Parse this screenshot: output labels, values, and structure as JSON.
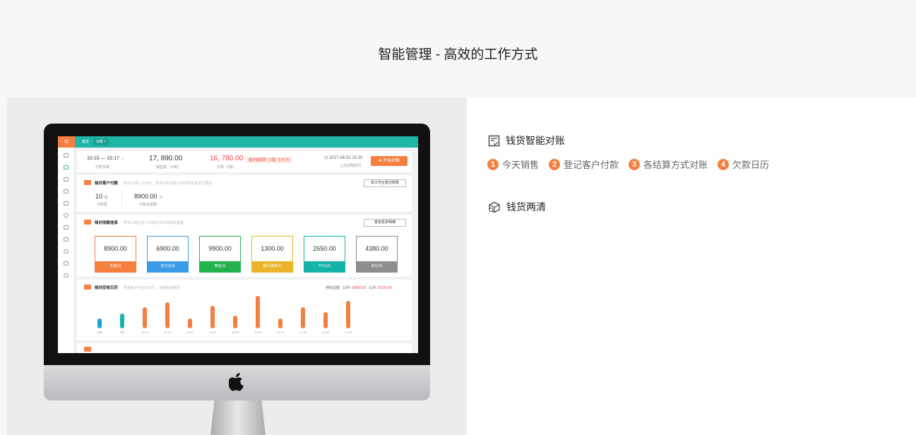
{
  "page_title": "智能管理 - 高效的工作方式",
  "colors": {
    "accent": "#f57f3f",
    "teal": "#1fb6a8"
  },
  "features": [
    {
      "icon": "reconcile-icon",
      "title": "钱货智能对账"
    },
    {
      "icon": "box-icon",
      "title": "钱货两清"
    }
  ],
  "steps": [
    {
      "num": "1",
      "label": "今天销售"
    },
    {
      "num": "2",
      "label": "登记客户付款"
    },
    {
      "num": "3",
      "label": "各结算方式对账"
    },
    {
      "num": "4",
      "label": "欠款日历"
    }
  ],
  "screen": {
    "tabs": [
      "首页",
      "对账 ×"
    ],
    "summary": {
      "date_range": "10.10 — 10.17",
      "date_sub": "付款日期",
      "sales_total": "17, 890.00",
      "sales_sub": "销售额（10笔）",
      "debt_total": "16, 780.00",
      "debt_sub": "欠款（9笔）",
      "debt_tag": "其中铺货款（2笔）6.47万",
      "datetime": "2017-08-31  15:30",
      "datetime_sub": "上次对账时间",
      "start_button": "开始对账"
    },
    "section1": {
      "title": "核对客户付款",
      "hint": "暂可以录入工作台，暂今日所有客户的付款信息进行登记",
      "button": "去工作台登记收款",
      "count": "10",
      "count_unit": "笔",
      "count_sub": "付款笔",
      "amount": "8900.00",
      "amount_unit": "元",
      "amount_sub": "付款总金额"
    },
    "section2": {
      "title": "核对收款信息",
      "hint": "暂可以核对各个结算方式中收款的金额",
      "button": "查看更多明细",
      "payments": [
        {
          "value": "8900.00",
          "label": "现金(3)",
          "color": "#f57f3f"
        },
        {
          "value": "6900.00",
          "label": "支付宝(3)",
          "color": "#3b9be8"
        },
        {
          "value": "9900.00",
          "label": "微信(3)",
          "color": "#22b24c"
        },
        {
          "value": "1300.00",
          "label": "银行转账(1)",
          "color": "#e9b42a"
        },
        {
          "value": "2650.00",
          "label": "POS(3)",
          "color": "#16b3a8"
        },
        {
          "value": "4380.00",
          "label": "其它(6)",
          "color": "#8e8e8e"
        }
      ]
    },
    "section3": {
      "title": "核对应收日历",
      "hint": "查看客户的应收日历，合理安排催款",
      "legend_label": "待收总额",
      "legend_a": "10月",
      "legend_a_val": "18900.00",
      "legend_b": "11月",
      "legend_b_val": "25100.00"
    }
  },
  "chart_data": {
    "type": "bar",
    "categories": [
      "以前",
      "今天",
      "10.12",
      "10.14",
      "10.20",
      "10.22",
      "10.25",
      "10.28",
      "11.12",
      "11.16",
      "11.18",
      "11.20"
    ],
    "values": [
      3,
      4.5,
      6.5,
      8,
      3,
      7,
      4,
      10,
      3,
      6.5,
      5,
      8.5
    ],
    "colors": [
      "#1aa7d8",
      "#16b3a8",
      "#f57f3f",
      "#f57f3f",
      "#f57f3f",
      "#f57f3f",
      "#f57f3f",
      "#f57f3f",
      "#f57f3f",
      "#f57f3f",
      "#f57f3f",
      "#f57f3f"
    ],
    "ylim": [
      0,
      10
    ]
  }
}
